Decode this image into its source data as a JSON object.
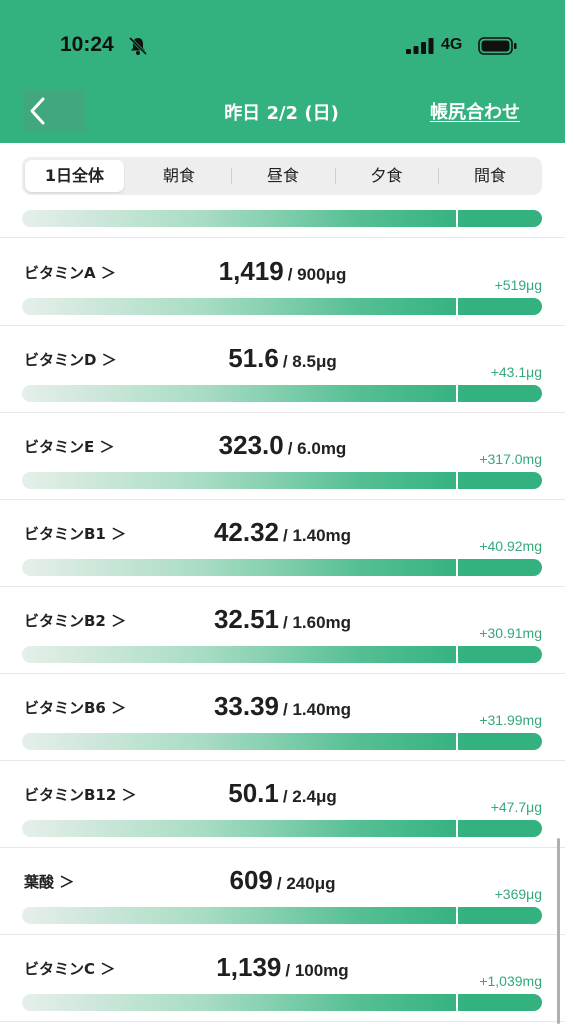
{
  "status_bar": {
    "time": "10:24",
    "network": "4G",
    "icons": [
      "bell-slash-icon",
      "signal-icon",
      "battery-icon"
    ]
  },
  "nav": {
    "back_icon": "chevron-left-icon",
    "title": "昨日 2/2 (日)",
    "action": "帳尻合わせ"
  },
  "tabs": [
    {
      "label": "1日全体",
      "active": true
    },
    {
      "label": "朝食",
      "active": false
    },
    {
      "label": "昼食",
      "active": false
    },
    {
      "label": "夕食",
      "active": false
    },
    {
      "label": "間食",
      "active": false
    }
  ],
  "nutrients": [
    {
      "name": "ビタミンA ＞",
      "value": "1,419",
      "target": "/ 900μg",
      "diff": "+519μg"
    },
    {
      "name": "ビタミンD ＞",
      "value": "51.6",
      "target": "/ 8.5μg",
      "diff": "+43.1μg"
    },
    {
      "name": "ビタミンE ＞",
      "value": "323.0",
      "target": "/ 6.0mg",
      "diff": "+317.0mg"
    },
    {
      "name": "ビタミンB1 ＞",
      "value": "42.32",
      "target": "/ 1.40mg",
      "diff": "+40.92mg"
    },
    {
      "name": "ビタミンB2 ＞",
      "value": "32.51",
      "target": "/ 1.60mg",
      "diff": "+30.91mg"
    },
    {
      "name": "ビタミンB6 ＞",
      "value": "33.39",
      "target": "/ 1.40mg",
      "diff": "+31.99mg"
    },
    {
      "name": "ビタミンB12 ＞",
      "value": "50.1",
      "target": "/ 2.4μg",
      "diff": "+47.7μg"
    },
    {
      "name": "葉酸 ＞",
      "value": "609",
      "target": "/ 240μg",
      "diff": "+369μg"
    },
    {
      "name": "ビタミンC ＞",
      "value": "1,139",
      "target": "/ 100mg",
      "diff": "+1,039mg"
    }
  ],
  "colors": {
    "brand": "#33b27f",
    "diff_text": "#35a87a",
    "tab_bg": "#eeeeee"
  }
}
